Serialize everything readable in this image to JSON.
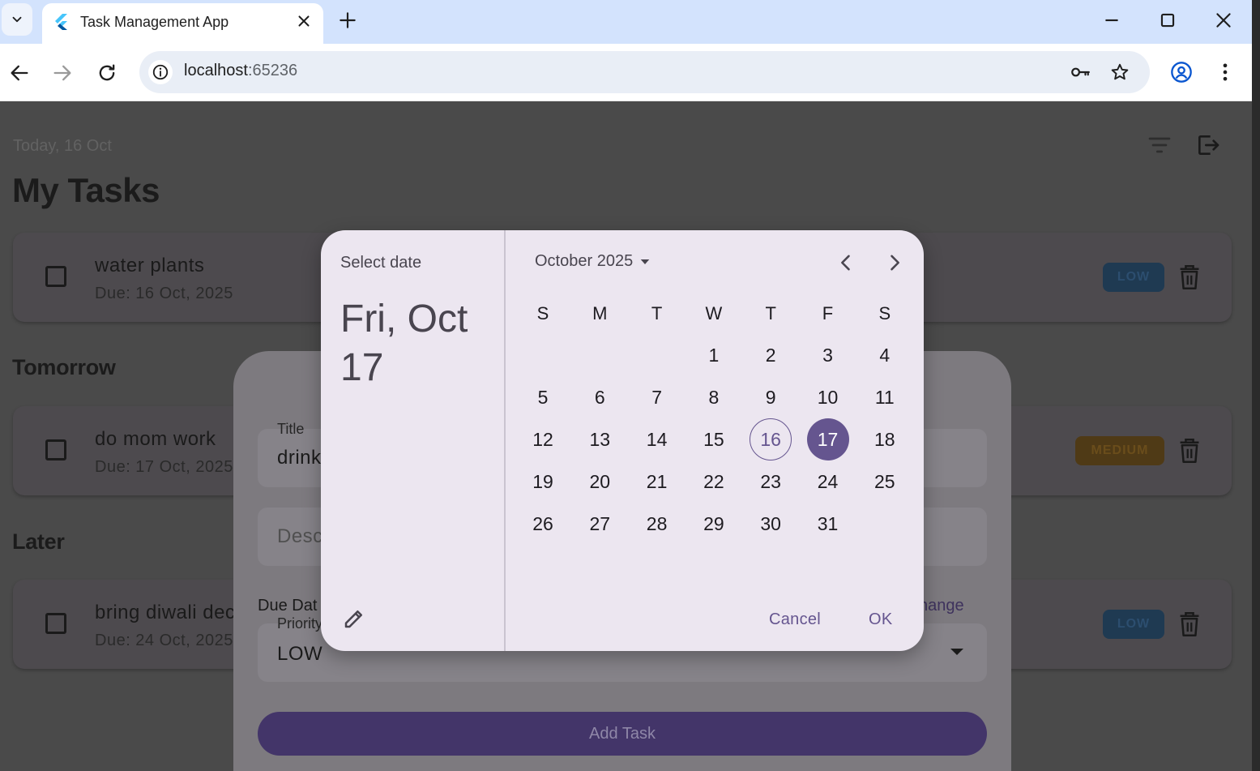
{
  "browser": {
    "tab_title": "Task Management App",
    "url_host": "localhost",
    "url_port": ":65236"
  },
  "app": {
    "today_label": "Today, 16 Oct",
    "page_title": "My Tasks",
    "sections": {
      "tomorrow": "Tomorrow",
      "later": "Later"
    },
    "tasks": [
      {
        "title": "water plants",
        "due": "Due: 16 Oct, 2025",
        "priority": "LOW"
      },
      {
        "title": "do mom work",
        "due": "Due: 17 Oct, 2025",
        "priority": "MEDIUM"
      },
      {
        "title": "bring diwali dec",
        "due": "Due: 24 Oct, 2025",
        "priority": "LOW"
      }
    ]
  },
  "sheet": {
    "title_label": "Title",
    "title_value": "drink",
    "description_placeholder": "Desc",
    "due_label": "Due Dat",
    "change_label": "hange",
    "priority_label": "Priority",
    "priority_value": "LOW",
    "add_button": "Add Task"
  },
  "date_picker": {
    "header_label": "Select date",
    "selected_date_text": "Fri, Oct 17",
    "month_label": "October 2025",
    "weekdays": [
      "S",
      "M",
      "T",
      "W",
      "T",
      "F",
      "S"
    ],
    "first_weekday_index": 3,
    "days_in_month": 31,
    "today": 16,
    "selected": 17,
    "cancel_label": "Cancel",
    "ok_label": "OK",
    "accent_color": "#65558f"
  }
}
